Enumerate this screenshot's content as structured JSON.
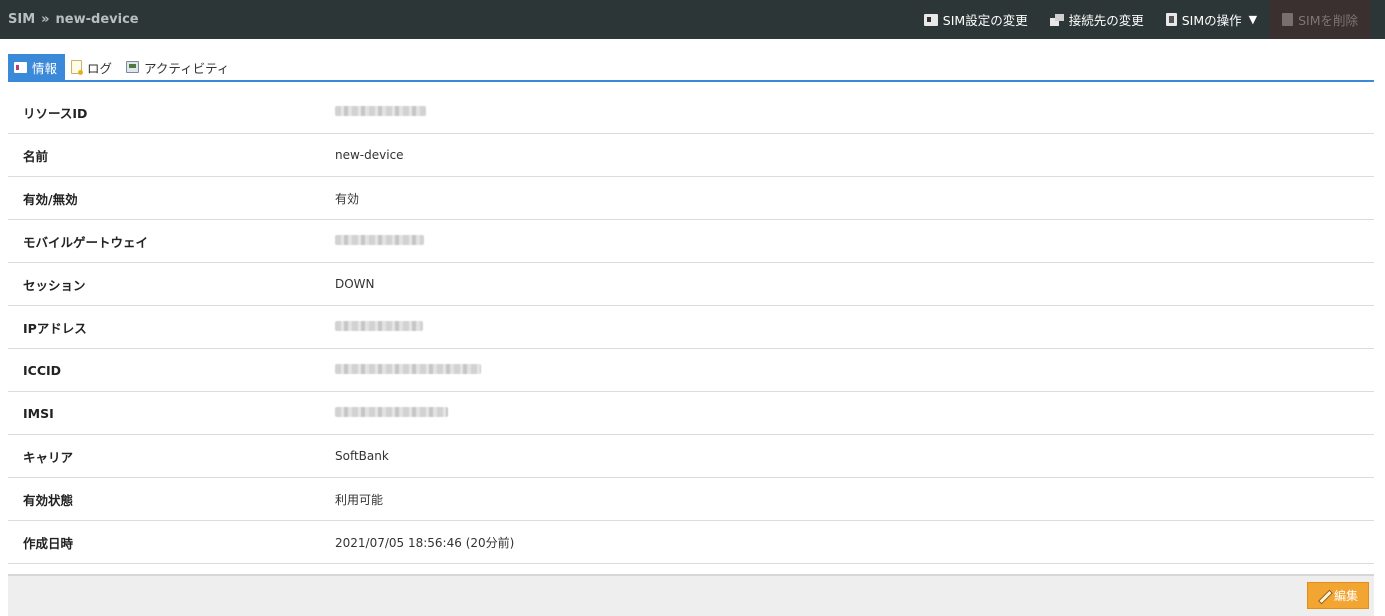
{
  "breadcrumb": {
    "root": "SIM",
    "separator": "»",
    "current": "new-device"
  },
  "actions": [
    {
      "label": "SIM設定の変更",
      "icon": "sim-card-icon"
    },
    {
      "label": "接続先の変更",
      "icon": "connection-icon"
    },
    {
      "label": "SIMの操作",
      "icon": "sim-operation-icon",
      "caret": "▼"
    },
    {
      "label": "SIMを削除",
      "icon": "delete-icon",
      "disabled": true
    }
  ],
  "tabs": [
    {
      "label": "情報",
      "icon": "info-card-icon",
      "active": true
    },
    {
      "label": "ログ",
      "icon": "log-document-icon"
    },
    {
      "label": "アクティビティ",
      "icon": "monitor-icon"
    }
  ],
  "rows": [
    {
      "key": "リソースID",
      "value": ""
    },
    {
      "key": "名前",
      "value": "new-device"
    },
    {
      "key": "有効/無効",
      "value": "有効"
    },
    {
      "key": "モバイルゲートウェイ",
      "value": ""
    },
    {
      "key": "セッション",
      "value": "DOWN"
    },
    {
      "key": "IPアドレス",
      "value": ""
    },
    {
      "key": "ICCID",
      "value": ""
    },
    {
      "key": "IMSI",
      "value": ""
    },
    {
      "key": "キャリア",
      "value": "SoftBank"
    },
    {
      "key": "有効状態",
      "value": "利用可能"
    },
    {
      "key": "作成日時",
      "value": "2021/07/05 18:56:46 (20分前)"
    }
  ],
  "footer": {
    "edit_label": "編集"
  },
  "colors": {
    "topbar": "#2d3636",
    "accent": "#3b8ad9",
    "edit_button": "#f2a531"
  }
}
